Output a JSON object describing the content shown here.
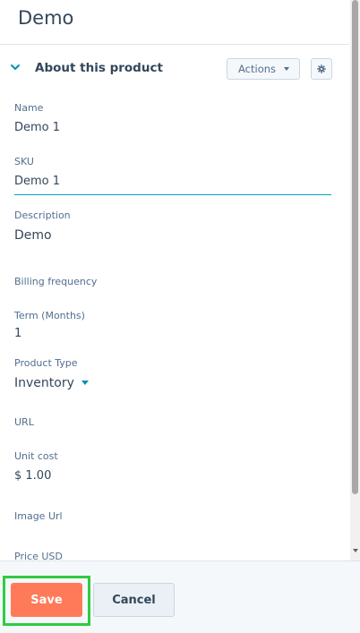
{
  "header": {
    "title": "Demo"
  },
  "section": {
    "title": "About this product",
    "actions_label": "Actions",
    "chevron_icon": "chevron-down-icon",
    "settings_icon": "gear-icon"
  },
  "fields": {
    "name": {
      "label": "Name",
      "value": "Demo 1"
    },
    "sku": {
      "label": "SKU",
      "value": "Demo 1"
    },
    "description": {
      "label": "Description",
      "value": "Demo"
    },
    "billing_frequency": {
      "label": "Billing frequency",
      "value": ""
    },
    "term_months": {
      "label": "Term (Months)",
      "value": "1"
    },
    "product_type": {
      "label": "Product Type",
      "value": "Inventory"
    },
    "url": {
      "label": "URL",
      "value": ""
    },
    "unit_cost": {
      "label": "Unit cost",
      "value": "$ 1.00"
    },
    "image_url": {
      "label": "Image Url",
      "value": ""
    },
    "price_usd": {
      "label": "Price USD",
      "value": ""
    }
  },
  "footer": {
    "save_label": "Save",
    "cancel_label": "Cancel"
  },
  "colors": {
    "accent": "#ff7a59",
    "focus_underline": "#00a4bd",
    "highlight": "#2ecc40",
    "text": "#33475b"
  }
}
